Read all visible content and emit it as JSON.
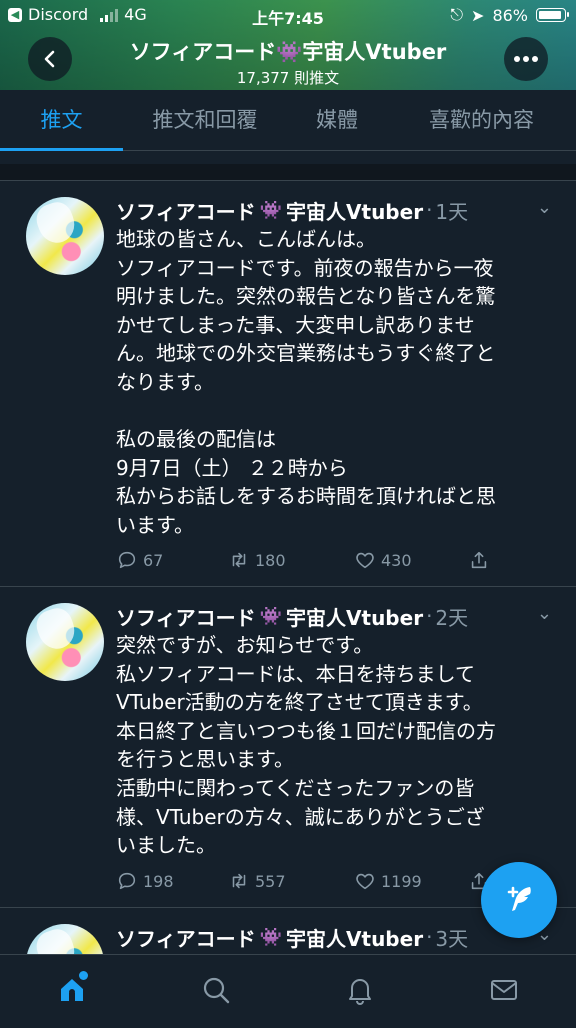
{
  "status_bar": {
    "back_app": "Discord",
    "network": "4G",
    "time": "上午7:45",
    "battery": "86%"
  },
  "header": {
    "profile_name": "ソフィアコード👾宇宙人Vtuber",
    "tweet_count": "17,377 則推文",
    "back_icon": "chevron-left-icon",
    "more_icon": "more-horizontal-icon"
  },
  "tabs": [
    {
      "label": "推文",
      "active": true
    },
    {
      "label": "推文和回覆",
      "active": false
    },
    {
      "label": "媒體",
      "active": false
    },
    {
      "label": "喜歡的內容",
      "active": false
    }
  ],
  "tweets": [
    {
      "name": "ソフィアコード",
      "name_suffix": "宇宙人Vtuber",
      "time": "1天",
      "text": "地球の皆さん、こんばんは。\nソフィアコードです。前夜の報告から一夜\n明けました。突然の報告となり皆さんを驚\nかせてしまった事、大変申し訳ありませ\nん。地球での外交官業務はもうすぐ終了と\nなります。\n\n私の最後の配信は\n9月7日（土） ２２時から\n私からお話しをするお時間を頂ければと思\nいます。",
      "replies": "67",
      "retweets": "180",
      "likes": "430"
    },
    {
      "name": "ソフィアコード",
      "name_suffix": "宇宙人Vtuber",
      "time": "2天",
      "text": "突然ですが、お知らせです。\n私ソフィアコードは、本日を持ちまして\nVTuber活動の方を終了させて頂きます。\n本日終了と言いつつも後１回だけ配信の方\nを行うと思います。\n活動中に関わってくださったファンの皆\n様、VTuberの方々、誠にありがとうござ\nいました。",
      "replies": "198",
      "retweets": "557",
      "likes": "1199"
    },
    {
      "name": "ソフィアコード",
      "name_suffix": "宇宙人Vtuber",
      "time": "3天",
      "text": "",
      "replies": "",
      "retweets": "",
      "likes": ""
    }
  ],
  "fab": {
    "icon": "compose-tweet-icon"
  },
  "bottom_nav": [
    {
      "icon": "home-icon",
      "active": true
    },
    {
      "icon": "search-icon",
      "active": false
    },
    {
      "icon": "notifications-bell-icon",
      "active": false
    },
    {
      "icon": "messages-envelope-icon",
      "active": false
    }
  ],
  "colors": {
    "background": "#15202b",
    "accent": "#1da1f2",
    "muted": "#8899a6",
    "divider": "#38444d"
  }
}
